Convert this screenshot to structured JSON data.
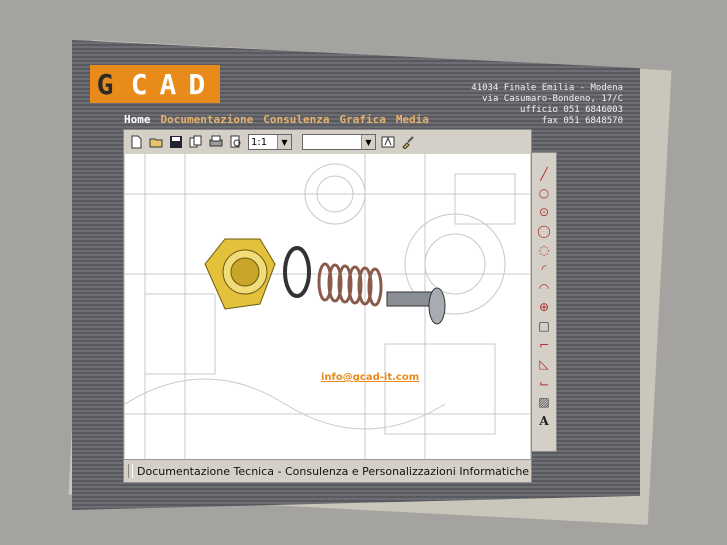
{
  "logo": {
    "letter1": "G",
    "letters": "CAD"
  },
  "address": {
    "line1": "41034 Finale Emilia - Modena",
    "line2": "via Casumaro-Bondeno, 17/C",
    "line3": "ufficio 051 6846003",
    "line4": "fax 051 6848570"
  },
  "nav": {
    "home": "Home",
    "documentazione": "Documentazione",
    "consulenza": "Consulenza",
    "grafica": "Grafica",
    "media": "Media"
  },
  "toolbar": {
    "zoom_value": "1:1",
    "layer_value": ""
  },
  "email": "info@gcad-it.com",
  "status": "Documentazione Tecnica - Consulenza e Personalizzazioni Informatiche",
  "colors": {
    "accent": "#e98b1a",
    "nav_text": "#e6b36d",
    "background": "#a4a39f"
  },
  "icons": {
    "toolbar": [
      "new-file-icon",
      "open-folder-icon",
      "save-icon",
      "copy-icon",
      "print-icon",
      "print-preview-icon",
      "text-style-icon",
      "brush-icon"
    ],
    "drawing_tools": [
      "line-icon",
      "circle-icon",
      "circle-center-icon",
      "ellipse-icon",
      "circle-tangent-icon",
      "arc-icon",
      "arc-center-icon",
      "crosshair-icon",
      "rectangle-icon",
      "fillet-icon",
      "chamfer-icon",
      "offset-icon",
      "hatch-icon",
      "text-icon"
    ]
  }
}
